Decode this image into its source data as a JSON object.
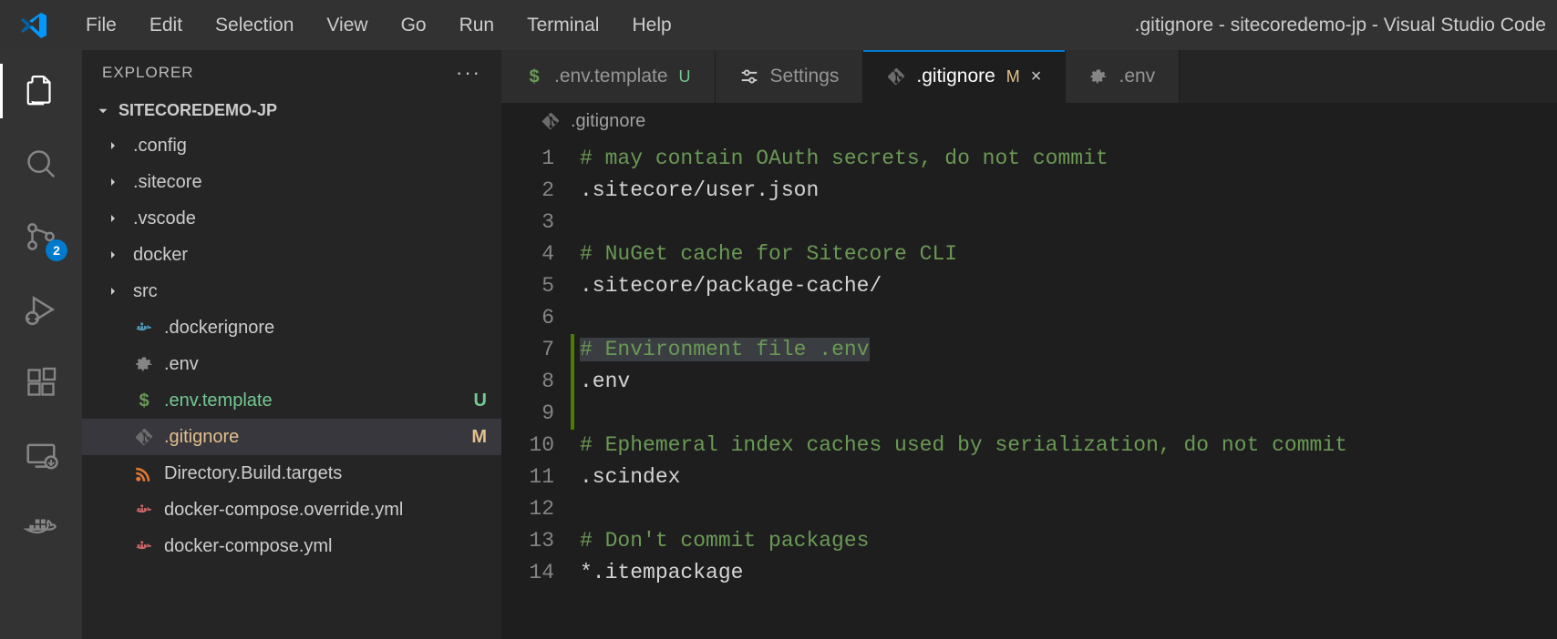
{
  "menubar": [
    "File",
    "Edit",
    "Selection",
    "View",
    "Go",
    "Run",
    "Terminal",
    "Help"
  ],
  "window_title": ".gitignore - sitecoredemo-jp - Visual Studio Code",
  "activitybar": {
    "scm_badge": "2"
  },
  "sidebar": {
    "title": "EXPLORER",
    "root": "SITECOREDEMO-JP",
    "items": [
      {
        "label": ".config",
        "kind": "folder"
      },
      {
        "label": ".sitecore",
        "kind": "folder"
      },
      {
        "label": ".vscode",
        "kind": "folder"
      },
      {
        "label": "docker",
        "kind": "folder"
      },
      {
        "label": "src",
        "kind": "folder"
      },
      {
        "label": ".dockerignore",
        "kind": "file",
        "icon": "docker"
      },
      {
        "label": ".env",
        "kind": "file",
        "icon": "gear"
      },
      {
        "label": ".env.template",
        "kind": "file",
        "icon": "dollar",
        "status": "U"
      },
      {
        "label": ".gitignore",
        "kind": "file",
        "icon": "git",
        "status": "M",
        "selected": true
      },
      {
        "label": "Directory.Build.targets",
        "kind": "file",
        "icon": "rss"
      },
      {
        "label": "docker-compose.override.yml",
        "kind": "file",
        "icon": "docker-red"
      },
      {
        "label": "docker-compose.yml",
        "kind": "file",
        "icon": "docker-red"
      }
    ]
  },
  "tabs": [
    {
      "label": ".env.template",
      "icon": "dollar",
      "status": "U"
    },
    {
      "label": "Settings",
      "icon": "settings-sliders"
    },
    {
      "label": ".gitignore",
      "icon": "git",
      "status": "M",
      "active": true,
      "close": true
    },
    {
      "label": ".env",
      "icon": "gear"
    }
  ],
  "breadcrumb": {
    "icon": "git",
    "text": ".gitignore"
  },
  "code": {
    "lines": [
      {
        "n": 1,
        "type": "comment",
        "text": "# may contain OAuth secrets, do not commit"
      },
      {
        "n": 2,
        "type": "plain",
        "text": ".sitecore/user.json"
      },
      {
        "n": 3,
        "type": "plain",
        "text": ""
      },
      {
        "n": 4,
        "type": "comment",
        "text": "# NuGet cache for Sitecore CLI"
      },
      {
        "n": 5,
        "type": "plain",
        "text": ".sitecore/package-cache/"
      },
      {
        "n": 6,
        "type": "plain",
        "text": ""
      },
      {
        "n": 7,
        "type": "comment-hl",
        "diff": true,
        "pre": "#",
        "mid_parts": [
          "Environment",
          "file",
          ".env"
        ],
        "sep": "·"
      },
      {
        "n": 8,
        "type": "plain",
        "diff": true,
        "text": ".env"
      },
      {
        "n": 9,
        "type": "plain",
        "diff": true,
        "text": ""
      },
      {
        "n": 10,
        "type": "comment",
        "text": "# Ephemeral index caches used by serialization, do not commit"
      },
      {
        "n": 11,
        "type": "plain",
        "text": ".scindex"
      },
      {
        "n": 12,
        "type": "plain",
        "text": ""
      },
      {
        "n": 13,
        "type": "comment",
        "text": "# Don't commit packages"
      },
      {
        "n": 14,
        "type": "plain",
        "text": "*.itempackage"
      }
    ]
  },
  "colors": {
    "dollar": "#6a9955",
    "docker_blue": "#519aba",
    "docker_red": "#cc6666",
    "rss": "#e37933",
    "gear": "#858585",
    "git": "#6c6c6c",
    "untracked": "#73c991",
    "modified": "#e2c08d"
  }
}
